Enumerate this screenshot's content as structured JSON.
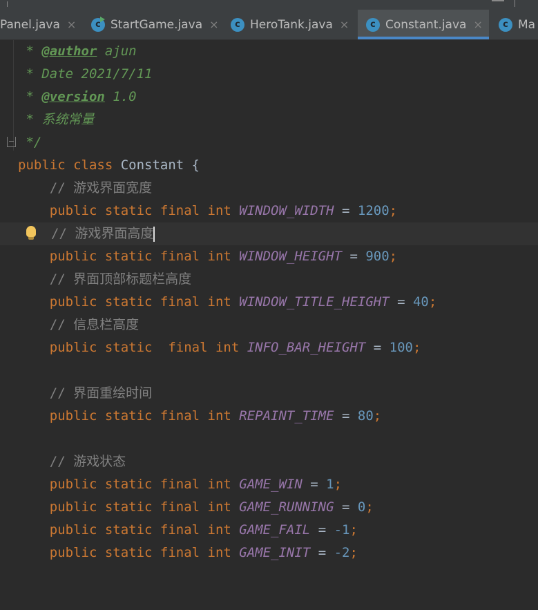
{
  "tabs": [
    {
      "label": "Panel.java",
      "icon": "none",
      "active": false
    },
    {
      "label": "StartGame.java",
      "icon": "java-class-run-icon",
      "active": false
    },
    {
      "label": "HeroTank.java",
      "icon": "java-class-icon",
      "active": false
    },
    {
      "label": "Constant.java",
      "icon": "java-class-icon",
      "active": true
    },
    {
      "label": "Ma",
      "icon": "java-class-icon",
      "active": false
    }
  ],
  "tab_icon_letter": "c",
  "tab_close_glyph": "×",
  "colors": {
    "background": "#2b2b2b",
    "keyword": "#cc7832",
    "field": "#9876aa",
    "number": "#6897bb",
    "comment": "#808080",
    "doc_comment": "#629755",
    "tab_underline": "#4a88c7"
  },
  "code": {
    "l1": {
      "star": " * ",
      "tag": "@author",
      "text": " ajun"
    },
    "l2": {
      "text": " * Date 2021/7/11"
    },
    "l3": {
      "star": " * ",
      "tag": "@version",
      "text": " 1.0"
    },
    "l4": {
      "text": " * 系统常量"
    },
    "l5": {
      "text": " */"
    },
    "l6": {
      "kw": "public class",
      "name": " Constant ",
      "brace": "{"
    },
    "l7": {
      "text": "    // 游戏界面宽度"
    },
    "l8": {
      "mods": "    public static final int ",
      "field": "WINDOW_WIDTH",
      "eq": " = ",
      "value": "1200",
      "semi": ";"
    },
    "l9": {
      "text": "// 游戏界面高度"
    },
    "l10": {
      "mods": "    public static final int ",
      "field": "WINDOW_HEIGHT",
      "eq": " = ",
      "value": "900",
      "semi": ";"
    },
    "l11": {
      "text": "    // 界面顶部标题栏高度"
    },
    "l12": {
      "mods": "    public static final int ",
      "field": "WINDOW_TITLE_HEIGHT",
      "eq": " = ",
      "value": "40",
      "semi": ";"
    },
    "l13": {
      "text": "    // 信息栏高度"
    },
    "l14": {
      "mods": "    public static  final int ",
      "field": "INFO_BAR_HEIGHT",
      "eq": " = ",
      "value": "100",
      "semi": ";"
    },
    "l16": {
      "text": "    // 界面重绘时间"
    },
    "l17": {
      "mods": "    public static final int ",
      "field": "REPAINT_TIME",
      "eq": " = ",
      "value": "80",
      "semi": ";"
    },
    "l19": {
      "text": "    // 游戏状态"
    },
    "l20": {
      "mods": "    public static final int ",
      "field": "GAME_WIN",
      "eq": " = ",
      "value": "1",
      "semi": ";"
    },
    "l21": {
      "mods": "    public static final int ",
      "field": "GAME_RUNNING",
      "eq": " = ",
      "value": "0",
      "semi": ";"
    },
    "l22": {
      "mods": "    public static final int ",
      "field": "GAME_FAIL",
      "eq": " = ",
      "value": "-1",
      "semi": ";"
    },
    "l23": {
      "mods": "    public static final int ",
      "field": "GAME_INIT",
      "eq": " = ",
      "value": "-2",
      "semi": ";"
    }
  }
}
